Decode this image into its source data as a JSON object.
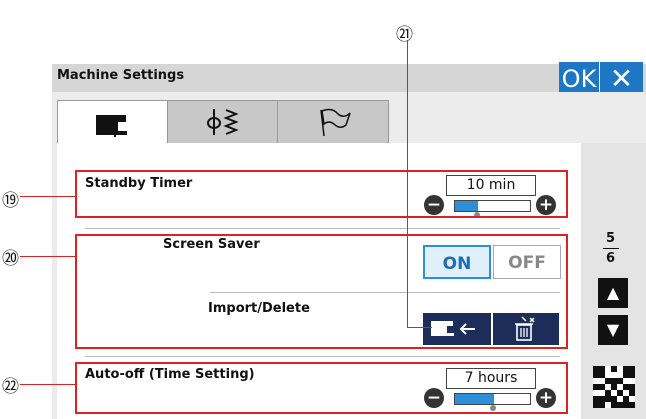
{
  "callouts": {
    "c19": "⑲",
    "c20": "⑳",
    "c21": "㉑",
    "c22": "㉒"
  },
  "window": {
    "title": "Machine Settings",
    "ok_label": "OK",
    "close_label": "✕"
  },
  "tabs": [
    {
      "icon": "sewing-machine-icon"
    },
    {
      "icon": "needle-stitch-icon"
    },
    {
      "icon": "flag-icon"
    }
  ],
  "standby": {
    "label": "Standby Timer",
    "value": "10 min",
    "level": 0.3
  },
  "screensaver": {
    "label": "Screen Saver",
    "on_label": "ON",
    "off_label": "OFF",
    "state": "ON",
    "import_label": "Import/Delete"
  },
  "autooff": {
    "label": "Auto-off (Time Setting)",
    "value": "7 hours",
    "level": 0.5
  },
  "pager": {
    "current": "5",
    "total": "6"
  },
  "colors": {
    "accent": "#1d77c4",
    "highlight": "#d22222",
    "dark_button": "#1c2d5a"
  }
}
